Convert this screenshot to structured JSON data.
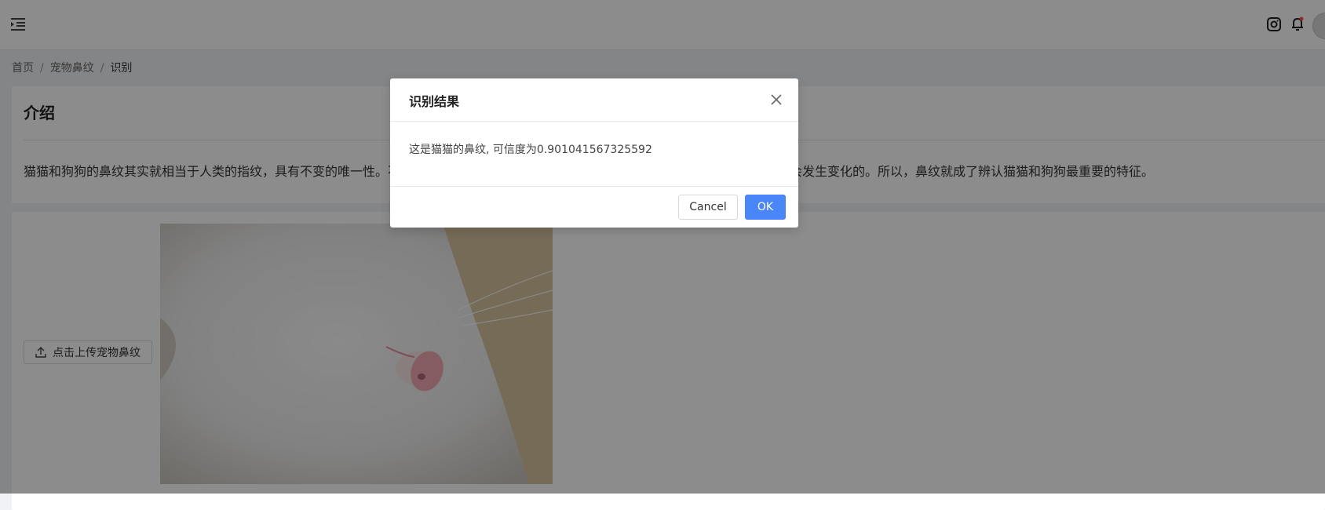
{
  "header": {
    "menu_icon": "menu-fold-icon",
    "icons": [
      "instagram-icon",
      "bell-icon",
      "avatar"
    ]
  },
  "breadcrumb": {
    "items": [
      "首页",
      "宠物鼻纹",
      "识别"
    ],
    "separator": "/"
  },
  "intro": {
    "title": "介绍",
    "text": "猫猫和狗狗的鼻纹其实就相当于人类的指纹，具有不变的唯一性。不同的猫猫狗狗的鼻纹都是不一样的，在它们的成长过程中，鼻纹也是不会发生变化的。所以，鼻纹就成了辨认猫猫和狗狗最重要的特征。"
  },
  "upload": {
    "button_label": "点击上传宠物鼻纹",
    "icon": "upload-icon"
  },
  "modal": {
    "title": "识别结果",
    "body": "这是猫猫的鼻纹, 可信度为0.901041567325592",
    "cancel_label": "Cancel",
    "ok_label": "OK",
    "close_icon": "close-icon"
  },
  "colors": {
    "primary": "#4a86f7",
    "mask": "rgba(0,0,0,0.45)"
  }
}
